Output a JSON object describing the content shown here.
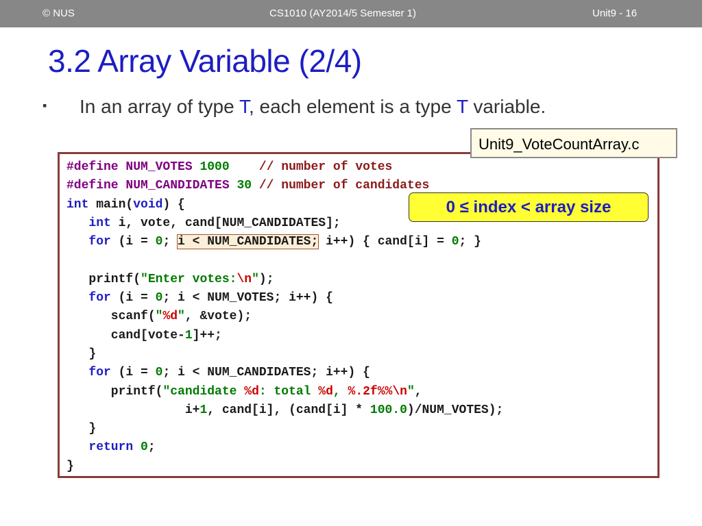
{
  "header": {
    "left": "© NUS",
    "center": "CS1010 (AY2014/5 Semester 1)",
    "right": "Unit9 - 16"
  },
  "title": "3.2 Array Variable (2/4)",
  "bullet": {
    "mark": "▪",
    "part1": "In an array of type ",
    "type_1": "T",
    "part2": ", each element is a type ",
    "type_2": "T",
    "part3": " variable."
  },
  "file_label": "Unit9_VoteCountArray.c",
  "callout": "0 ≤ index < array size",
  "code": [
    [
      {
        "t": "#define ",
        "c": "pp"
      },
      {
        "t": "NUM_VOTES ",
        "c": "pp"
      },
      {
        "t": "1000",
        "c": "num"
      },
      {
        "t": "    ",
        "c": ""
      },
      {
        "t": "// number of votes",
        "c": "cm"
      }
    ],
    [
      {
        "t": "#define ",
        "c": "pp"
      },
      {
        "t": "NUM_CANDIDATES ",
        "c": "pp"
      },
      {
        "t": "30",
        "c": "num"
      },
      {
        "t": " ",
        "c": ""
      },
      {
        "t": "// number of candidates",
        "c": "cm"
      }
    ],
    [
      {
        "t": "int",
        "c": "kw"
      },
      {
        "t": " main(",
        "c": ""
      },
      {
        "t": "void",
        "c": "kw"
      },
      {
        "t": ") {",
        "c": ""
      }
    ],
    [
      {
        "t": "   ",
        "c": ""
      },
      {
        "t": "int",
        "c": "kw"
      },
      {
        "t": " i, vote, cand[NUM_CANDIDATES];",
        "c": ""
      }
    ],
    [
      {
        "t": "   ",
        "c": ""
      },
      {
        "t": "for",
        "c": "kw"
      },
      {
        "t": " (i = ",
        "c": ""
      },
      {
        "t": "0",
        "c": "num"
      },
      {
        "t": "; ",
        "c": ""
      },
      {
        "t": "i < NUM_CANDIDATES;",
        "c": "hl-box"
      },
      {
        "t": " i++) ",
        "c": ""
      },
      {
        "t": "{",
        "c": ""
      },
      {
        "t": " cand[i] = ",
        "c": ""
      },
      {
        "t": "0",
        "c": "num"
      },
      {
        "t": "; }",
        "c": ""
      }
    ],
    [
      {
        "t": "",
        "c": ""
      }
    ],
    [
      {
        "t": "   printf(",
        "c": ""
      },
      {
        "t": "\"Enter votes:",
        "c": "str"
      },
      {
        "t": "\\n",
        "c": "fmt"
      },
      {
        "t": "\"",
        "c": "str"
      },
      {
        "t": ");",
        "c": ""
      }
    ],
    [
      {
        "t": "   ",
        "c": ""
      },
      {
        "t": "for",
        "c": "kw"
      },
      {
        "t": " (i = ",
        "c": ""
      },
      {
        "t": "0",
        "c": "num"
      },
      {
        "t": "; i < NUM_VOTES; i++) {",
        "c": ""
      }
    ],
    [
      {
        "t": "      scanf(",
        "c": ""
      },
      {
        "t": "\"",
        "c": "str"
      },
      {
        "t": "%d",
        "c": "fmt"
      },
      {
        "t": "\"",
        "c": "str"
      },
      {
        "t": ", &vote);",
        "c": ""
      }
    ],
    [
      {
        "t": "      cand[vote-",
        "c": ""
      },
      {
        "t": "1",
        "c": "num"
      },
      {
        "t": "]++;",
        "c": ""
      }
    ],
    [
      {
        "t": "   }",
        "c": ""
      }
    ],
    [
      {
        "t": "   ",
        "c": ""
      },
      {
        "t": "for",
        "c": "kw"
      },
      {
        "t": " (i = ",
        "c": ""
      },
      {
        "t": "0",
        "c": "num"
      },
      {
        "t": "; i < NUM_CANDIDATES; i++) {",
        "c": ""
      }
    ],
    [
      {
        "t": "      printf(",
        "c": ""
      },
      {
        "t": "\"candidate ",
        "c": "str"
      },
      {
        "t": "%d",
        "c": "fmt"
      },
      {
        "t": ": total ",
        "c": "str"
      },
      {
        "t": "%d",
        "c": "fmt"
      },
      {
        "t": ", ",
        "c": "str"
      },
      {
        "t": "%.2f%%",
        "c": "fmt"
      },
      {
        "t": "\\n",
        "c": "fmt"
      },
      {
        "t": "\"",
        "c": "str"
      },
      {
        "t": ",",
        "c": ""
      }
    ],
    [
      {
        "t": "                i+",
        "c": ""
      },
      {
        "t": "1",
        "c": "num"
      },
      {
        "t": ", cand[i], (cand[i] * ",
        "c": ""
      },
      {
        "t": "100.0",
        "c": "num"
      },
      {
        "t": ")/NUM_VOTES);",
        "c": ""
      }
    ],
    [
      {
        "t": "   }",
        "c": ""
      }
    ],
    [
      {
        "t": "   ",
        "c": ""
      },
      {
        "t": "return",
        "c": "kw"
      },
      {
        "t": " ",
        "c": ""
      },
      {
        "t": "0",
        "c": "num"
      },
      {
        "t": ";",
        "c": ""
      }
    ],
    [
      {
        "t": "}",
        "c": ""
      }
    ]
  ]
}
